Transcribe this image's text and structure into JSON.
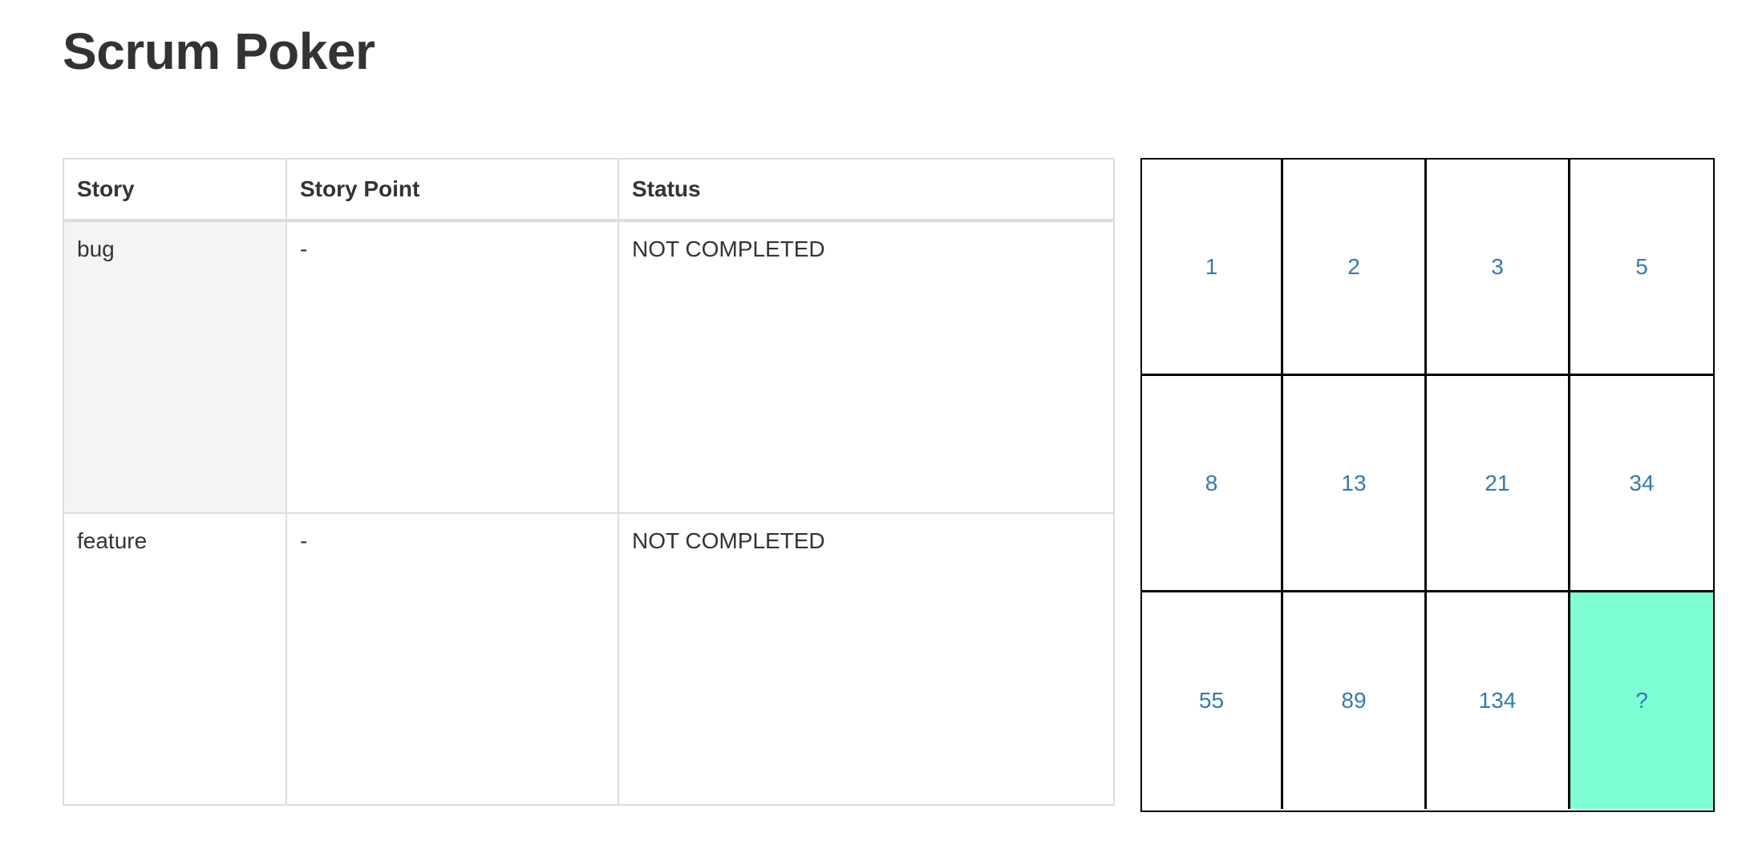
{
  "page": {
    "title": "Scrum Poker"
  },
  "table": {
    "headers": {
      "story": "Story",
      "story_point": "Story Point",
      "status": "Status"
    },
    "rows": [
      {
        "story": "bug",
        "story_point": "-",
        "status": "NOT COMPLETED"
      },
      {
        "story": "feature",
        "story_point": "-",
        "status": "NOT COMPLETED"
      }
    ]
  },
  "cards": {
    "values": [
      "1",
      "2",
      "3",
      "5",
      "8",
      "13",
      "21",
      "34",
      "55",
      "89",
      "134",
      "?"
    ],
    "selected_value": "?",
    "selected_color": "#7fffd4",
    "link_color": "#337ab7"
  }
}
